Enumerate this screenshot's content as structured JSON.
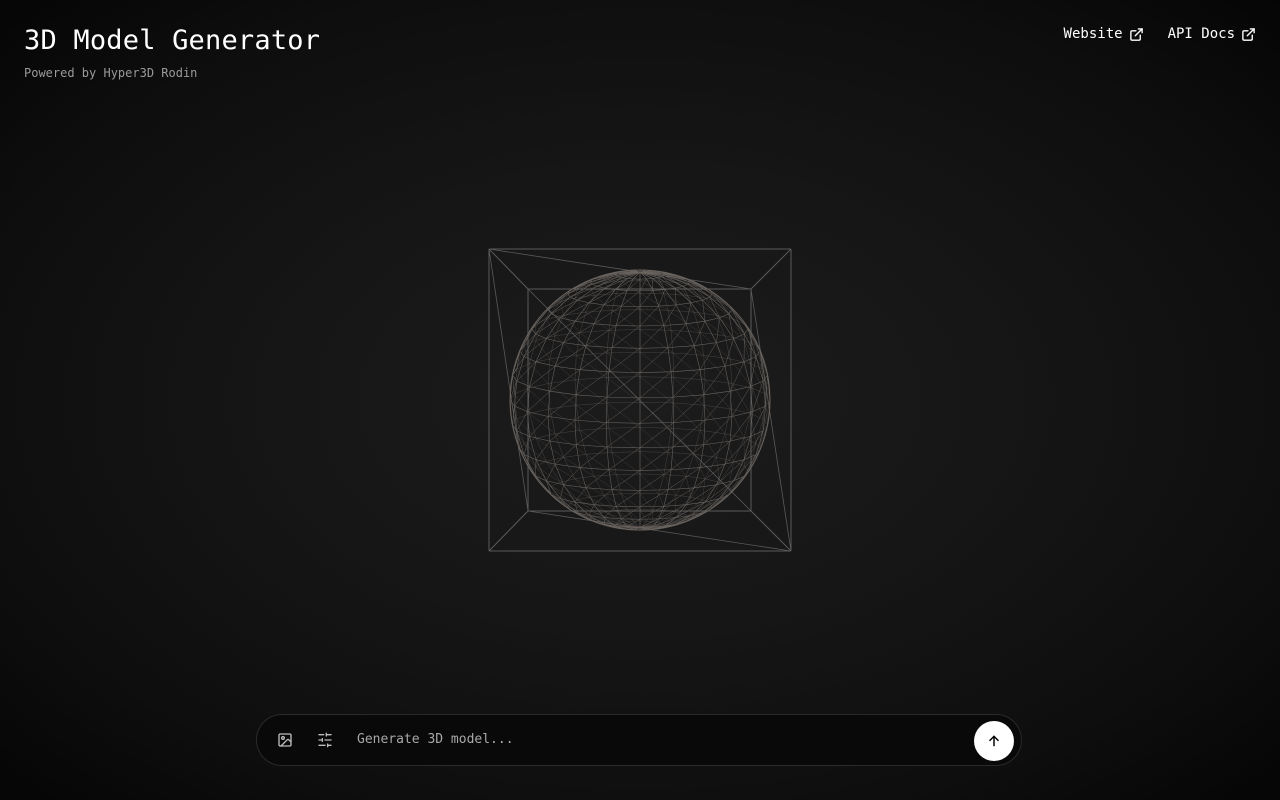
{
  "header": {
    "title": "3D Model Generator",
    "subtitle": "Powered by Hyper3D Rodin"
  },
  "nav": {
    "links": [
      {
        "label": "Website",
        "icon": "external-link-icon"
      },
      {
        "label": "API Docs",
        "icon": "external-link-icon"
      }
    ]
  },
  "viewer": {
    "model": "wireframe-sphere",
    "wire_color": "#6b6560",
    "frame_color": "#5a5a5a"
  },
  "prompt": {
    "placeholder": "Generate 3D model...",
    "value": "",
    "image_icon": "image-icon",
    "settings_icon": "sliders-icon",
    "submit_icon": "arrow-up-icon"
  },
  "colors": {
    "background": "#151515",
    "text": "#ffffff",
    "muted": "#9a9a9a",
    "submit_bg": "#ffffff"
  }
}
